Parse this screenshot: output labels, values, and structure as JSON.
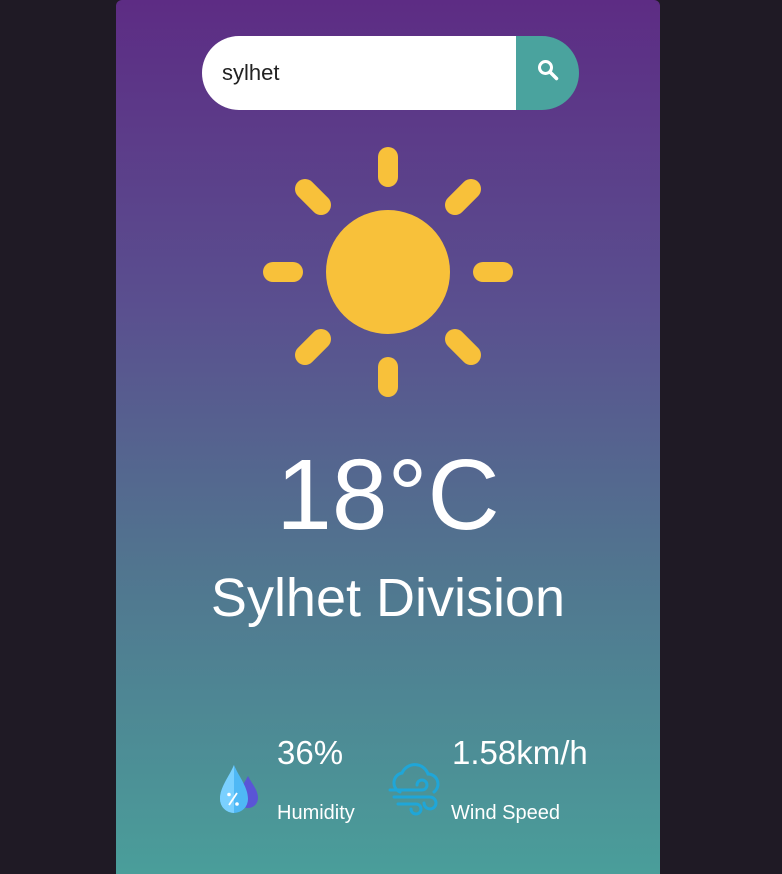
{
  "search": {
    "value": "sylhet"
  },
  "weather": {
    "icon": "sun-icon",
    "temperature": "18°C",
    "city": "Sylhet Division"
  },
  "details": {
    "humidity": {
      "value": "36%",
      "label": "Humidity",
      "icon": "humidity-icon"
    },
    "wind": {
      "value": "1.58km/h",
      "label": "Wind Speed",
      "icon": "wind-icon"
    }
  },
  "colors": {
    "page_background": "#1f1a25",
    "gradient_top": "#5d2c84",
    "gradient_bottom": "#4a9e9a",
    "search_button": "#4aa39e",
    "sun": "#f8c13a"
  }
}
